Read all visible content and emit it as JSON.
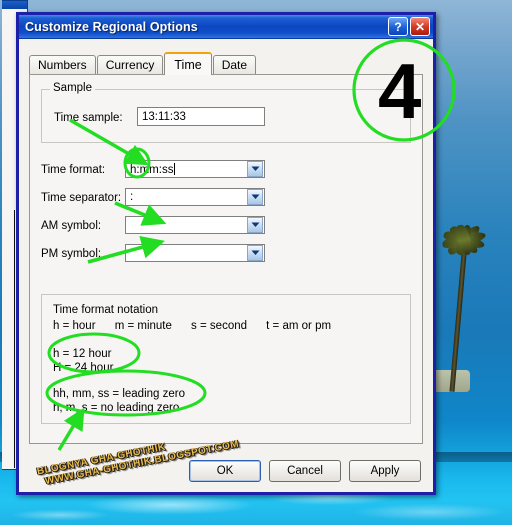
{
  "window": {
    "title": "Customize Regional Options",
    "help_button_label": "?",
    "close_button_label": "✕"
  },
  "tabs": [
    {
      "label": "Numbers",
      "active": false
    },
    {
      "label": "Currency",
      "active": false
    },
    {
      "label": "Time",
      "active": true
    },
    {
      "label": "Date",
      "active": false
    }
  ],
  "sample_group": {
    "title": "Sample",
    "time_sample_label": "Time sample:",
    "time_sample_value": "13:11:33"
  },
  "fields": {
    "time_format_label": "Time format:",
    "time_format_value": "h:mm:ss",
    "time_separator_label": "Time separator:",
    "time_separator_value": ":",
    "am_symbol_label": "AM symbol:",
    "am_symbol_value": "",
    "pm_symbol_label": "PM symbol:",
    "pm_symbol_value": ""
  },
  "notation_group": {
    "heading": "Time format notation",
    "legend_line": "h = hour      m = minute      s = second      t = am or pm",
    "hour12": "h = 12 hour",
    "hour24": "H = 24 hour",
    "leading_zero": "hh, mm, ss = leading zero",
    "no_leading_zero": "h, m, s = no leading zero"
  },
  "buttons": {
    "ok": "OK",
    "cancel": "Cancel",
    "apply": "Apply"
  },
  "annotations": {
    "step_number": "4",
    "accent_color": "#22dd22",
    "watermark_line1": "BLOGNYA GHA-GHOTHIK",
    "watermark_line2": "WWW.GHA-GHOTHIK.BLOGSPOT.COM"
  },
  "colors": {
    "titlebar_blue": "#0b46c0",
    "dialog_border": "#1c1fa8",
    "dialog_face": "#f3f2ef",
    "active_tab_accent": "#f0a30a",
    "annotation_green": "#22dd22",
    "close_red": "#d9402a"
  }
}
